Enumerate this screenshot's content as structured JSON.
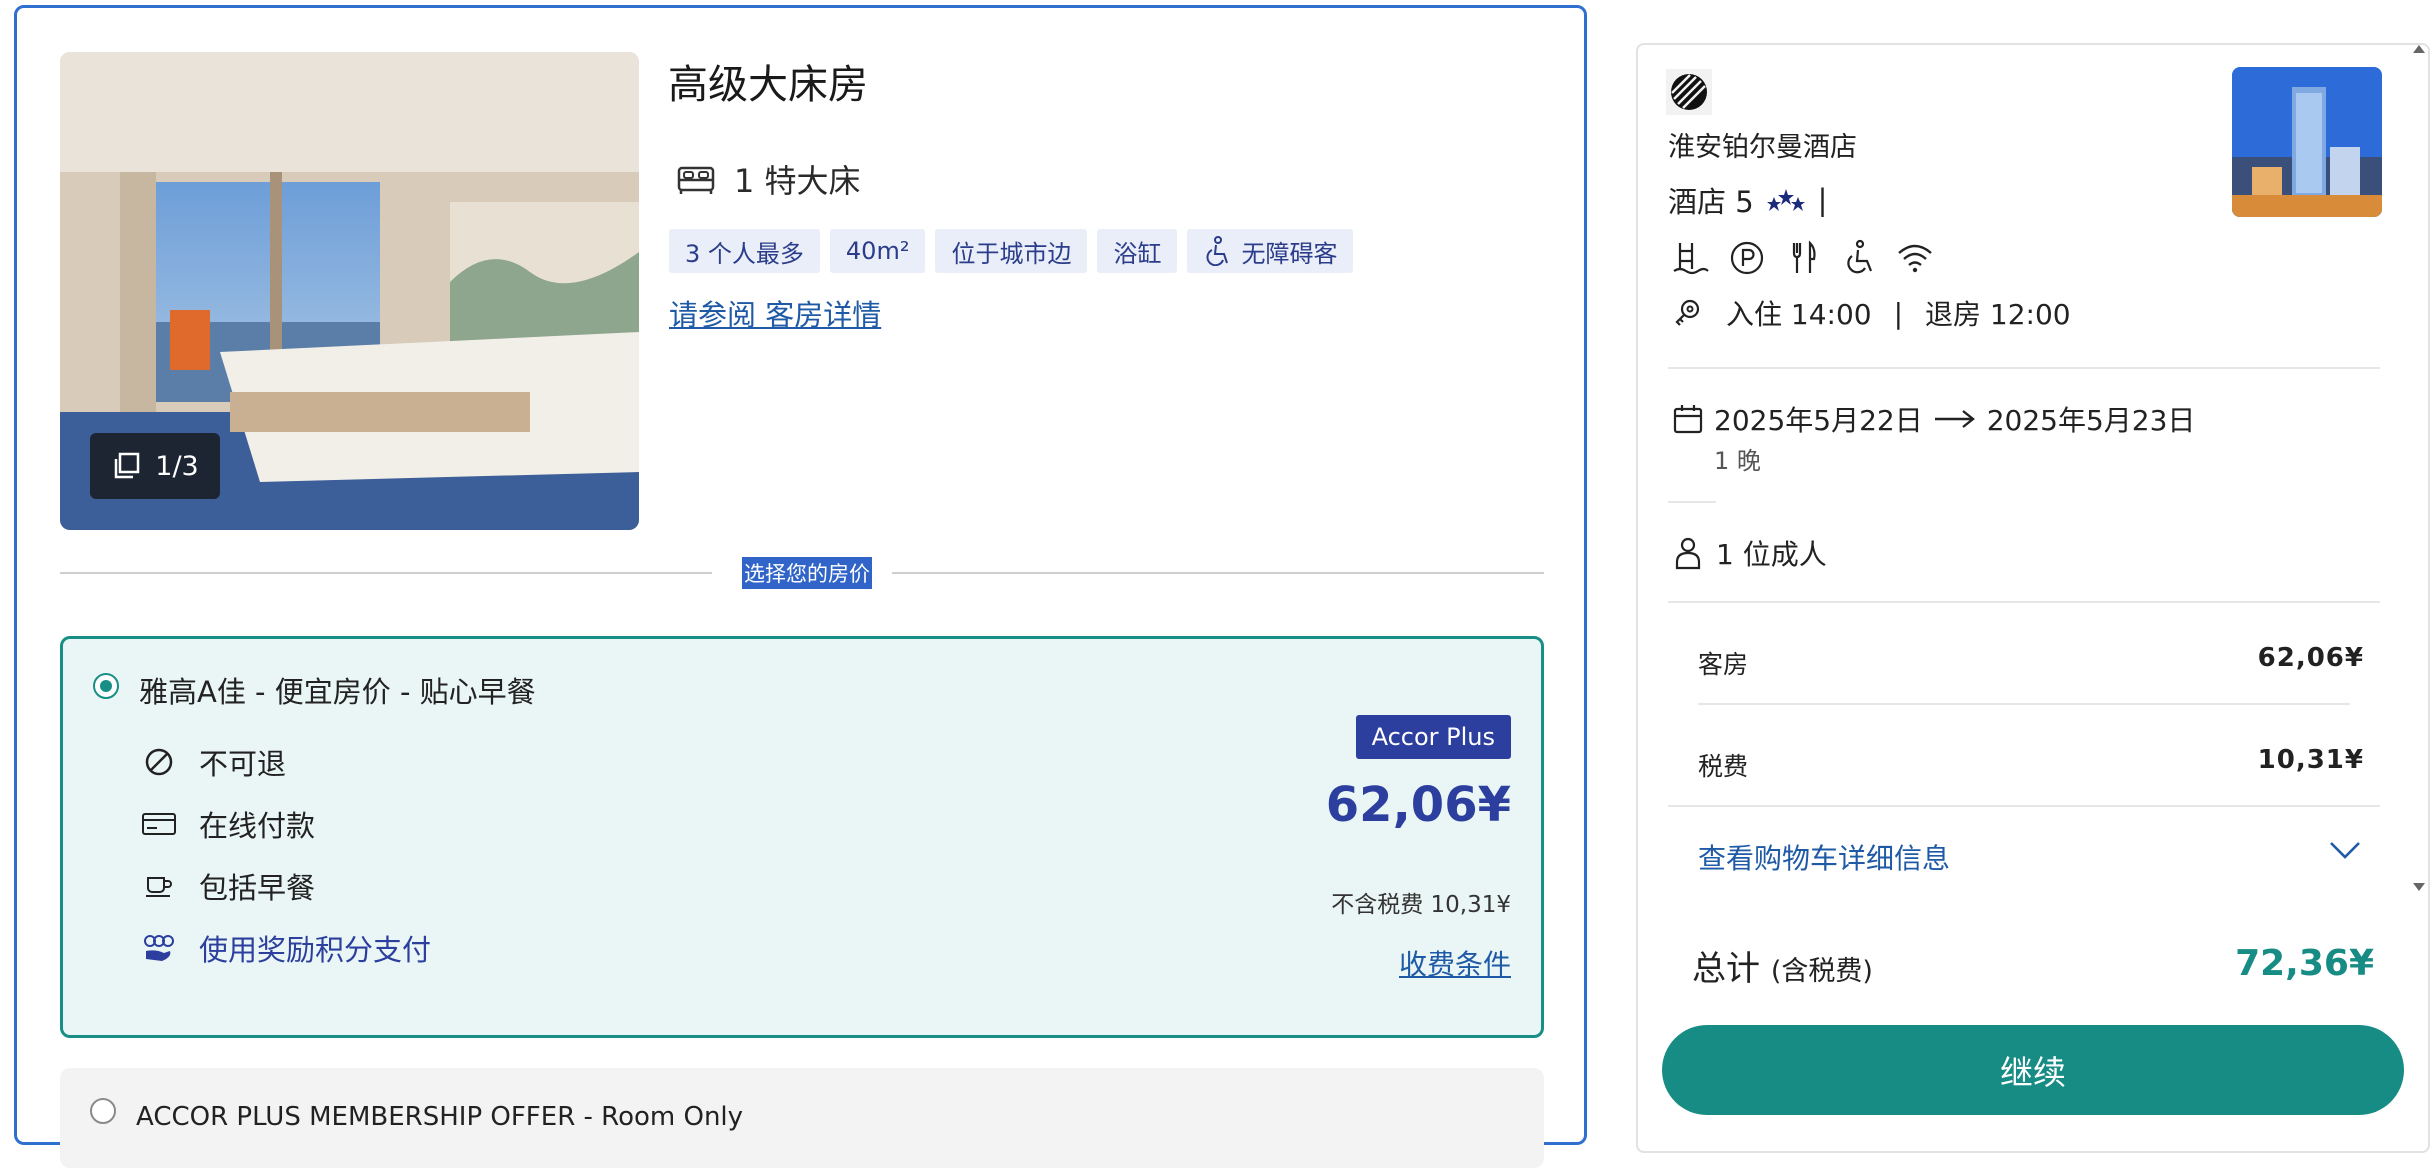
{
  "room": {
    "title": "高级大床房",
    "photo_counter": "1/3",
    "bed": "1 特大床",
    "tags": [
      "3 个人最多",
      "40m²",
      "位于城市边",
      "浴缸"
    ],
    "accessible_tag": "无障碍客",
    "details_link": "请参阅 客房详情",
    "select_rate_label": "选择您的房价"
  },
  "rates": [
    {
      "name": "雅高A佳 - 便宜房价 - 贴心早餐",
      "features": [
        {
          "icon": "no-cancel-icon",
          "label": "不可退"
        },
        {
          "icon": "credit-card-icon",
          "label": "在线付款"
        },
        {
          "icon": "coffee-cup-icon",
          "label": "包括早餐"
        },
        {
          "icon": "rewards-points-icon",
          "label": "使用奖励积分支付"
        }
      ],
      "badge": "Accor Plus",
      "price": "62,06¥",
      "tax_note": "不含税费 10,31¥",
      "conditions_link": "收费条件",
      "selected": true
    },
    {
      "name": "ACCOR PLUS MEMBERSHIP OFFER - Room Only",
      "selected": false
    }
  ],
  "summary": {
    "hotel_name": "淮安铂尔曼酒店",
    "rating_text": "酒店 5",
    "rating_separator": "|",
    "amenity_icons": [
      "pool-icon",
      "parking-icon",
      "restaurant-icon",
      "accessibility-icon",
      "wifi-icon"
    ],
    "checkin": "入住 14:00",
    "checkin_separator": "|",
    "checkout": "退房 12:00",
    "date_from": "2025年5月22日",
    "date_to": "2025年5月23日",
    "nights": "1 晚",
    "guests": "1 位成人",
    "room_label": "客房",
    "room_value": "62,06¥",
    "tax_label": "税费",
    "tax_value": "10,31¥",
    "cart_link": "查看购物车详细信息",
    "total_label": "总计",
    "total_suffix": "(含税费)",
    "total_value": "72,36¥",
    "continue_label": "继续"
  },
  "colors": {
    "accent_teal": "#178c84",
    "brand_blue": "#2c3f9e",
    "link_blue": "#1f5aa6"
  }
}
